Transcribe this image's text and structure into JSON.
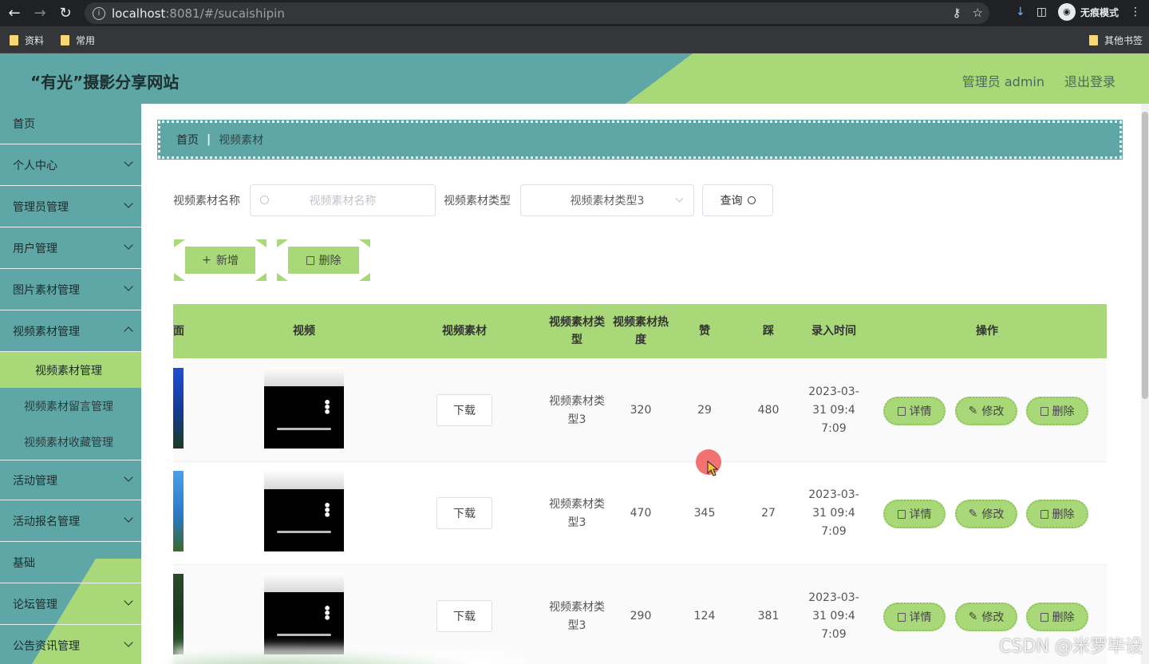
{
  "browser": {
    "url_host": "localhost",
    "url_rest": ":8081/#/sucaishipin",
    "incognito_label": "无痕模式",
    "bookmarks": [
      "资料",
      "常用"
    ],
    "other_bookmarks": "其他书签"
  },
  "header": {
    "title": "“有光”摄影分享网站",
    "user": "管理员 admin",
    "logout": "退出登录"
  },
  "sidebar": {
    "items": [
      {
        "label": "首页"
      },
      {
        "label": "个人中心"
      },
      {
        "label": "管理员管理"
      },
      {
        "label": "用户管理"
      },
      {
        "label": "图片素材管理"
      },
      {
        "label": "视频素材管理"
      },
      {
        "label": "活动管理"
      },
      {
        "label": "活动报名管理"
      },
      {
        "label": "基础"
      },
      {
        "label": "论坛管理"
      },
      {
        "label": "公告资讯管理"
      }
    ],
    "subitems": [
      {
        "label": "视频素材管理",
        "active": true
      },
      {
        "label": "视频素材留言管理"
      },
      {
        "label": "视频素材收藏管理"
      }
    ]
  },
  "breadcrumb": {
    "home": "首页",
    "current": "视频素材"
  },
  "search": {
    "name_label": "视频素材名称",
    "name_placeholder": "视频素材名称",
    "type_label": "视频素材类型",
    "type_value": "视频素材类型3",
    "query_button": "查询"
  },
  "actions": {
    "add": "新增",
    "delete": "删除"
  },
  "table": {
    "headers": {
      "image": "面",
      "video": "视频",
      "material": "视频素材",
      "type": "视频素材类型",
      "heat": "视频素材热度",
      "like": "赞",
      "dislike": "踩",
      "time": "录入时间",
      "ops": "操作"
    },
    "download_label": "下载",
    "op_labels": {
      "detail": "详情",
      "edit": "修改",
      "delete": "删除"
    },
    "rows": [
      {
        "type": "视频素材类型3",
        "heat": "320",
        "like": "29",
        "dislike": "480",
        "time": "2023-03-31 09:47:09"
      },
      {
        "type": "视频素材类型3",
        "heat": "470",
        "like": "345",
        "dislike": "27",
        "time": "2023-03-31 09:47:09"
      },
      {
        "type": "视频素材类型3",
        "heat": "290",
        "like": "124",
        "dislike": "381",
        "time": "2023-03-31 09:47:09"
      }
    ]
  },
  "watermark": "CSDN @米罗毕设",
  "colors": {
    "teal": "#5fa7a7",
    "green": "#a8d878"
  }
}
